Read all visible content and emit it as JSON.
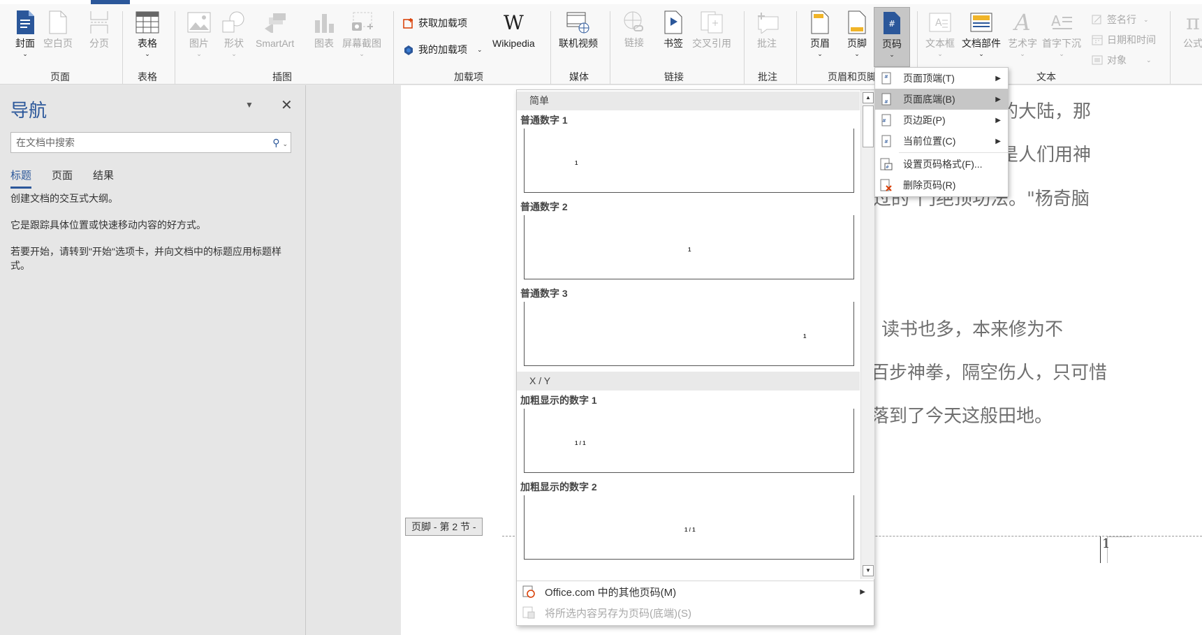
{
  "ribbon": {
    "groups": {
      "pages": "页面",
      "tables": "表格",
      "illustrations": "插图",
      "addins": "加载项",
      "media": "媒体",
      "links": "链接",
      "comments": "批注",
      "header_footer": "页眉和页脚",
      "text": "文本"
    },
    "buttons": {
      "cover": "封面",
      "blank_page": "空白页",
      "page_break": "分页",
      "table": "表格",
      "picture": "图片",
      "shapes": "形状",
      "smartart": "SmartArt",
      "chart": "图表",
      "screenshot": "屏幕截图",
      "get_addins": "获取加载项",
      "my_addins": "我的加载项",
      "wikipedia": "Wikipedia",
      "online_video": "联机视频",
      "link": "链接",
      "bookmark": "书签",
      "cross_ref": "交叉引用",
      "comment": "批注",
      "header": "页眉",
      "footer": "页脚",
      "page_number": "页码",
      "textbox": "文本框",
      "quick_parts": "文档部件",
      "wordart": "艺术字",
      "drop_cap": "首字下沉",
      "signature": "签名行",
      "datetime": "日期和时间",
      "object": "对象",
      "equation": "公式"
    }
  },
  "nav": {
    "title": "导航",
    "search_placeholder": "在文档中搜索",
    "tabs": [
      "标题",
      "页面",
      "结果"
    ],
    "para1": "创建文档的交互式大纲。",
    "para2": "它是跟踪具体位置或快速移动内容的好方式。",
    "para3": "若要开始，请转到\"开始\"选项卡，并向文档中的标题应用标题样式。"
  },
  "document": {
    "lines": [
      "的大陆，那",
      "是人们用神",
      "过的\"门绝顶功法。\"杨奇脑",
      "读书也多，本来修为不",
      "百步神拳，隔空伤人，只可惜",
      "落到了今天这般田地。"
    ],
    "footer_tag": "页脚 - 第 2 节 -",
    "page_number": "1"
  },
  "gallery": {
    "categories": [
      {
        "name": "简单",
        "items": [
          {
            "title": "普通数字 1",
            "sample": "1",
            "align": "left"
          },
          {
            "title": "普通数字 2",
            "sample": "1",
            "align": "center"
          },
          {
            "title": "普通数字 3",
            "sample": "1",
            "align": "right"
          }
        ]
      },
      {
        "name": "X / Y",
        "items": [
          {
            "title": "加粗显示的数字 1",
            "sample": "1 / 1",
            "align": "left"
          },
          {
            "title": "加粗显示的数字 2",
            "sample": "1 / 1",
            "align": "center"
          }
        ]
      }
    ],
    "more_office": "Office.com 中的其他页码(M)",
    "save_selection": "将所选内容另存为页码(底端)(S)"
  },
  "submenu": {
    "items": [
      {
        "label": "页面顶端(T)",
        "has_arrow": true
      },
      {
        "label": "页面底端(B)",
        "has_arrow": true,
        "hover": true
      },
      {
        "label": "页边距(P)",
        "has_arrow": true
      },
      {
        "label": "当前位置(C)",
        "has_arrow": true
      },
      {
        "label": "设置页码格式(F)...",
        "has_arrow": false
      },
      {
        "label": "删除页码(R)",
        "has_arrow": false
      }
    ]
  },
  "colors": {
    "accent": "#2b579a",
    "addin_orange": "#d83b01"
  }
}
